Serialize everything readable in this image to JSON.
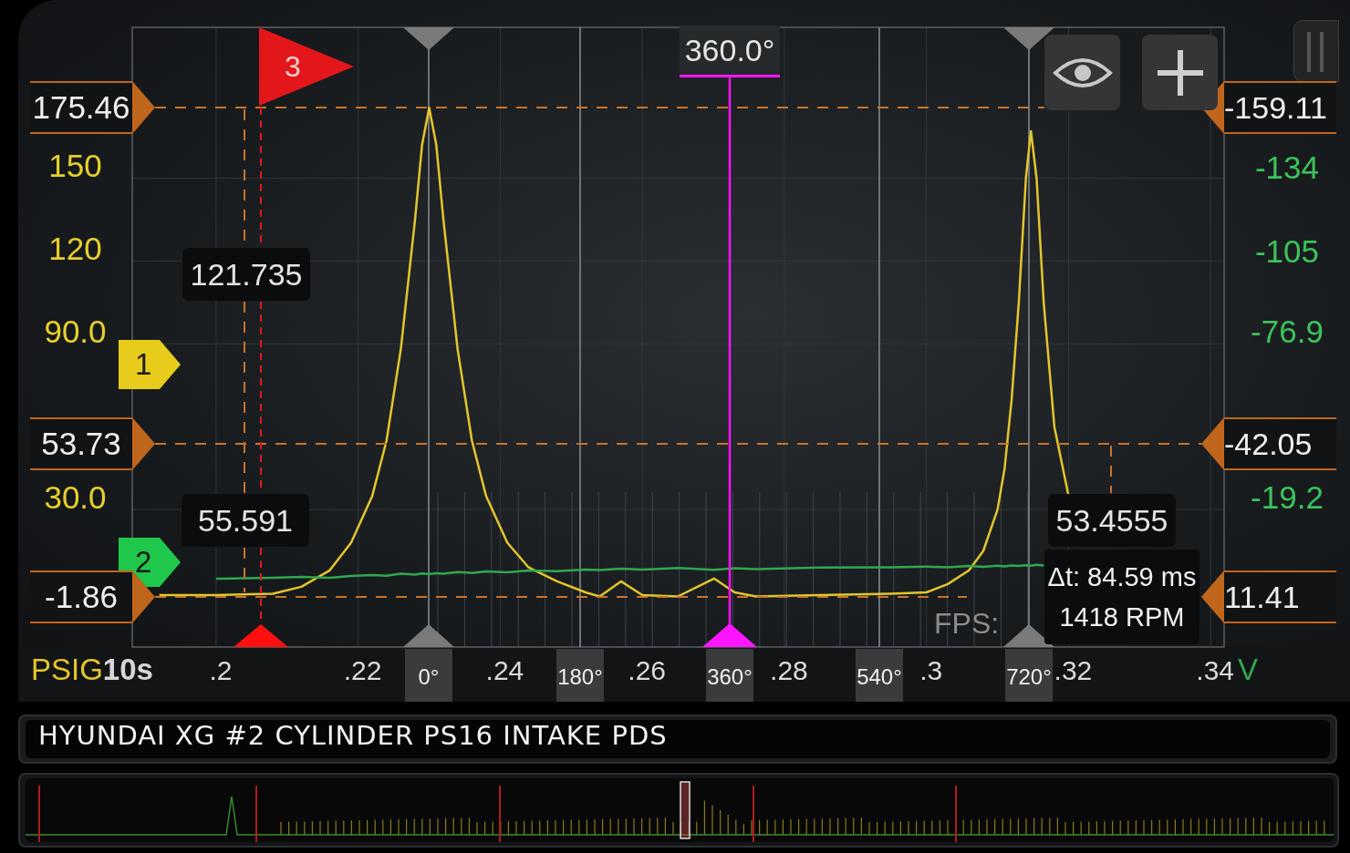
{
  "scope": {
    "chart_data": {
      "type": "line",
      "xlabel": "10s",
      "xlim": [
        0.1882,
        0.3419
      ],
      "ylim": [
        -19.8,
        204.6
      ],
      "y2lim": [
        28.7,
        -187.0
      ],
      "xticks": [
        {
          "value": 0.2,
          "label": ".2"
        },
        {
          "value": 0.22,
          "label": ".22"
        },
        {
          "value": 0.24,
          "label": ".24"
        },
        {
          "value": 0.26,
          "label": ".26"
        },
        {
          "value": 0.28,
          "label": ".28"
        },
        {
          "value": 0.3,
          "label": ".3"
        },
        {
          "value": 0.32,
          "label": ".32"
        },
        {
          "value": 0.34,
          "label": ".34"
        }
      ],
      "yticks": [
        {
          "value": 150,
          "label": "150"
        },
        {
          "value": 120,
          "label": "120"
        },
        {
          "value": 90,
          "label": "90.0"
        },
        {
          "value": 30,
          "label": "30.0"
        }
      ],
      "y2ticks": [
        {
          "value": -134,
          "label": "-134"
        },
        {
          "value": -105,
          "label": "-105"
        },
        {
          "value": -76.9,
          "label": "-76.9"
        },
        {
          "value": -19.2,
          "label": "-19.2"
        }
      ],
      "x": [
        0.192,
        0.2,
        0.208,
        0.212,
        0.216,
        0.219,
        0.222,
        0.224,
        0.226,
        0.228,
        0.229,
        0.23,
        0.231,
        0.232,
        0.234,
        0.236,
        0.238,
        0.241,
        0.244,
        0.248,
        0.252,
        0.254,
        0.257,
        0.26,
        0.265,
        0.2701,
        0.273,
        0.276,
        0.285,
        0.295,
        0.3,
        0.303,
        0.306,
        0.308,
        0.31,
        0.311,
        0.312,
        0.313,
        0.314,
        0.3147,
        0.3155,
        0.3165,
        0.318,
        0.32
      ],
      "series": [
        {
          "name": "PSIG",
          "color": "#e3c52c",
          "values": [
            -1,
            -1,
            -0.5,
            2,
            8,
            18,
            35,
            55,
            88,
            135,
            162,
            175.5,
            162,
            135,
            88,
            55,
            35,
            18,
            9,
            4,
            0,
            -1.5,
            4,
            -1,
            -1.5,
            5,
            0,
            -1.5,
            -1,
            -0.5,
            0,
            3,
            8,
            15,
            30,
            45,
            70,
            105,
            150,
            167,
            150,
            105,
            60,
            35
          ]
        },
        {
          "name": "V",
          "color": "#2fa84f",
          "axis": "y2",
          "values": [
            null,
            4.9,
            4.6,
            4.3,
            4.6,
            4.0,
            3.6,
            3.9,
            3.2,
            3.5,
            3.1,
            3.3,
            3.0,
            3.2,
            2.6,
            2.9,
            2.4,
            2.7,
            2.1,
            2.3,
            1.7,
            1.9,
            1.4,
            1.7,
            1.2,
            1.8,
            1.3,
            1.6,
            1.0,
            0.9,
            0.7,
            0.9,
            0.5,
            0.8,
            0.4,
            0.6,
            0.3,
            0.5,
            0.2,
            0.4,
            0.1,
            0.3,
            null,
            null
          ]
        }
      ]
    },
    "degree_lines": [
      {
        "label": "0°",
        "marker": true
      },
      {
        "label": "180°",
        "marker": false
      },
      {
        "label": "360°",
        "marker": false
      },
      {
        "label": "540°",
        "marker": false
      },
      {
        "label": "720°",
        "marker": true
      }
    ],
    "cursors": [
      {
        "left_label": "175.46",
        "right_label": "-159.11"
      },
      {
        "left_label": "53.73",
        "right_label": "-42.05"
      },
      {
        "left_label": "-1.86",
        "right_label": "11.41"
      }
    ],
    "trigger": {
      "label": "3"
    },
    "crank_cursor": {
      "label": "360.0°"
    },
    "channel_markers": [
      {
        "label": "1",
        "color": "#e8cc1c"
      },
      {
        "label": "2",
        "color": "#1fc84a"
      }
    ],
    "readouts": [
      "121.735",
      "55.591",
      "53.4555"
    ],
    "measurement": {
      "fps_label": "FPS:",
      "delta": "Δt: 84.59 ms",
      "rpm": "1418 RPM"
    }
  },
  "title_bar": {
    "title": "HYUNDAI XG #2 CYLINDER PS16 INTAKE PDS"
  }
}
